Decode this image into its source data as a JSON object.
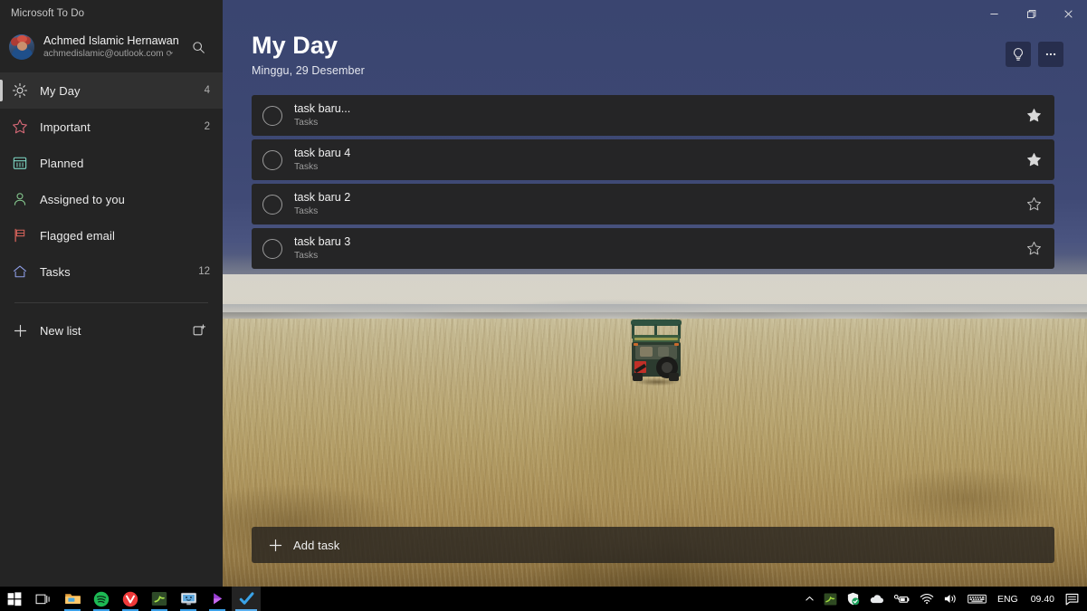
{
  "window": {
    "app_title": "Microsoft To Do",
    "controls": {
      "minimize": "minimize-icon",
      "restore": "restore-icon",
      "close": "close-icon"
    }
  },
  "sidebar": {
    "account": {
      "name": "Achmed Islamic Hernawan",
      "email": "achmedislamic@outlook.com",
      "sync_glyph": "⟳",
      "avatar": "avatar"
    },
    "search_icon": "search-icon",
    "items": [
      {
        "label": "My Day",
        "count": "4",
        "icon": "sun-icon",
        "selected": true
      },
      {
        "label": "Important",
        "count": "2",
        "icon": "star-icon",
        "selected": false
      },
      {
        "label": "Planned",
        "count": "",
        "icon": "calendar-icon",
        "selected": false
      },
      {
        "label": "Assigned to you",
        "count": "",
        "icon": "person-icon",
        "selected": false
      },
      {
        "label": "Flagged email",
        "count": "",
        "icon": "flag-icon",
        "selected": false
      },
      {
        "label": "Tasks",
        "count": "12",
        "icon": "home-icon",
        "selected": false
      }
    ],
    "new_list": {
      "label": "New list",
      "plus_icon": "plus-icon",
      "new_group_icon": "new-group-icon"
    }
  },
  "main": {
    "title": "My Day",
    "subtitle": "Minggu, 29 Desember",
    "actions": {
      "suggestions": "lightbulb-icon",
      "more": "more-options-icon"
    },
    "tasks": [
      {
        "title": "task baru...",
        "list": "Tasks",
        "important": true
      },
      {
        "title": "task baru 4",
        "list": "Tasks",
        "important": true
      },
      {
        "title": "task baru 2",
        "list": "Tasks",
        "important": false
      },
      {
        "title": "task baru 3",
        "list": "Tasks",
        "important": false
      }
    ],
    "add_task": {
      "label": "Add task",
      "icon": "plus-icon"
    },
    "background": "savanna-jeep-photo"
  },
  "taskbar": {
    "apps": [
      {
        "name": "start-button",
        "icon": "windows-logo-icon"
      },
      {
        "name": "task-view-button",
        "icon": "task-view-icon"
      },
      {
        "name": "file-explorer",
        "icon": "folder-icon"
      },
      {
        "name": "spotify",
        "icon": "spotify-icon"
      },
      {
        "name": "vivaldi",
        "icon": "vivaldi-icon"
      },
      {
        "name": "app-green",
        "icon": "green-app-icon"
      },
      {
        "name": "monitor-app",
        "icon": "monitor-icon"
      },
      {
        "name": "media-app",
        "icon": "purple-play-icon"
      },
      {
        "name": "microsoft-todo",
        "icon": "todo-check-icon"
      }
    ],
    "tray": {
      "chevron": "chevron-up-icon",
      "icons": [
        {
          "name": "nvidia-tray-icon",
          "icon": "green-square-icon"
        },
        {
          "name": "security-tray-icon",
          "icon": "shield-icon"
        },
        {
          "name": "onedrive-tray-icon",
          "icon": "cloud-icon"
        },
        {
          "name": "battery-tray-icon",
          "icon": "battery-icon"
        },
        {
          "name": "network-tray-icon",
          "icon": "wifi-icon"
        },
        {
          "name": "volume-tray-icon",
          "icon": "speaker-icon"
        },
        {
          "name": "keyboard-tray-icon",
          "icon": "keyboard-icon"
        }
      ],
      "language": "ENG",
      "clock": "09.40",
      "notifications": "notification-icon"
    }
  },
  "colors": {
    "sidebar_bg": "#242424",
    "header_blue": "#3a4570",
    "task_row_bg": "#252526",
    "accent": "#3aa0e8",
    "important_star": "#d8d8d8"
  }
}
